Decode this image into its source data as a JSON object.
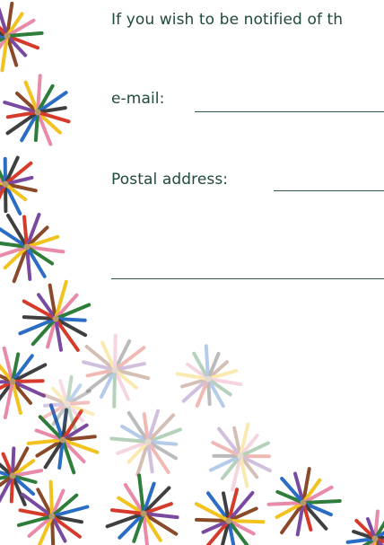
{
  "form": {
    "intro_text": "If you wish to be notified of th",
    "email_label": "e-mail:",
    "postal_label": "Postal address:"
  },
  "decor": {
    "name": "starburst-border",
    "palette": [
      "#2f7d3a",
      "#d63a2a",
      "#f2c21f",
      "#2b6cc4",
      "#7a4aa0",
      "#e88aa8",
      "#3f3f3f",
      "#8a4a2a"
    ]
  }
}
